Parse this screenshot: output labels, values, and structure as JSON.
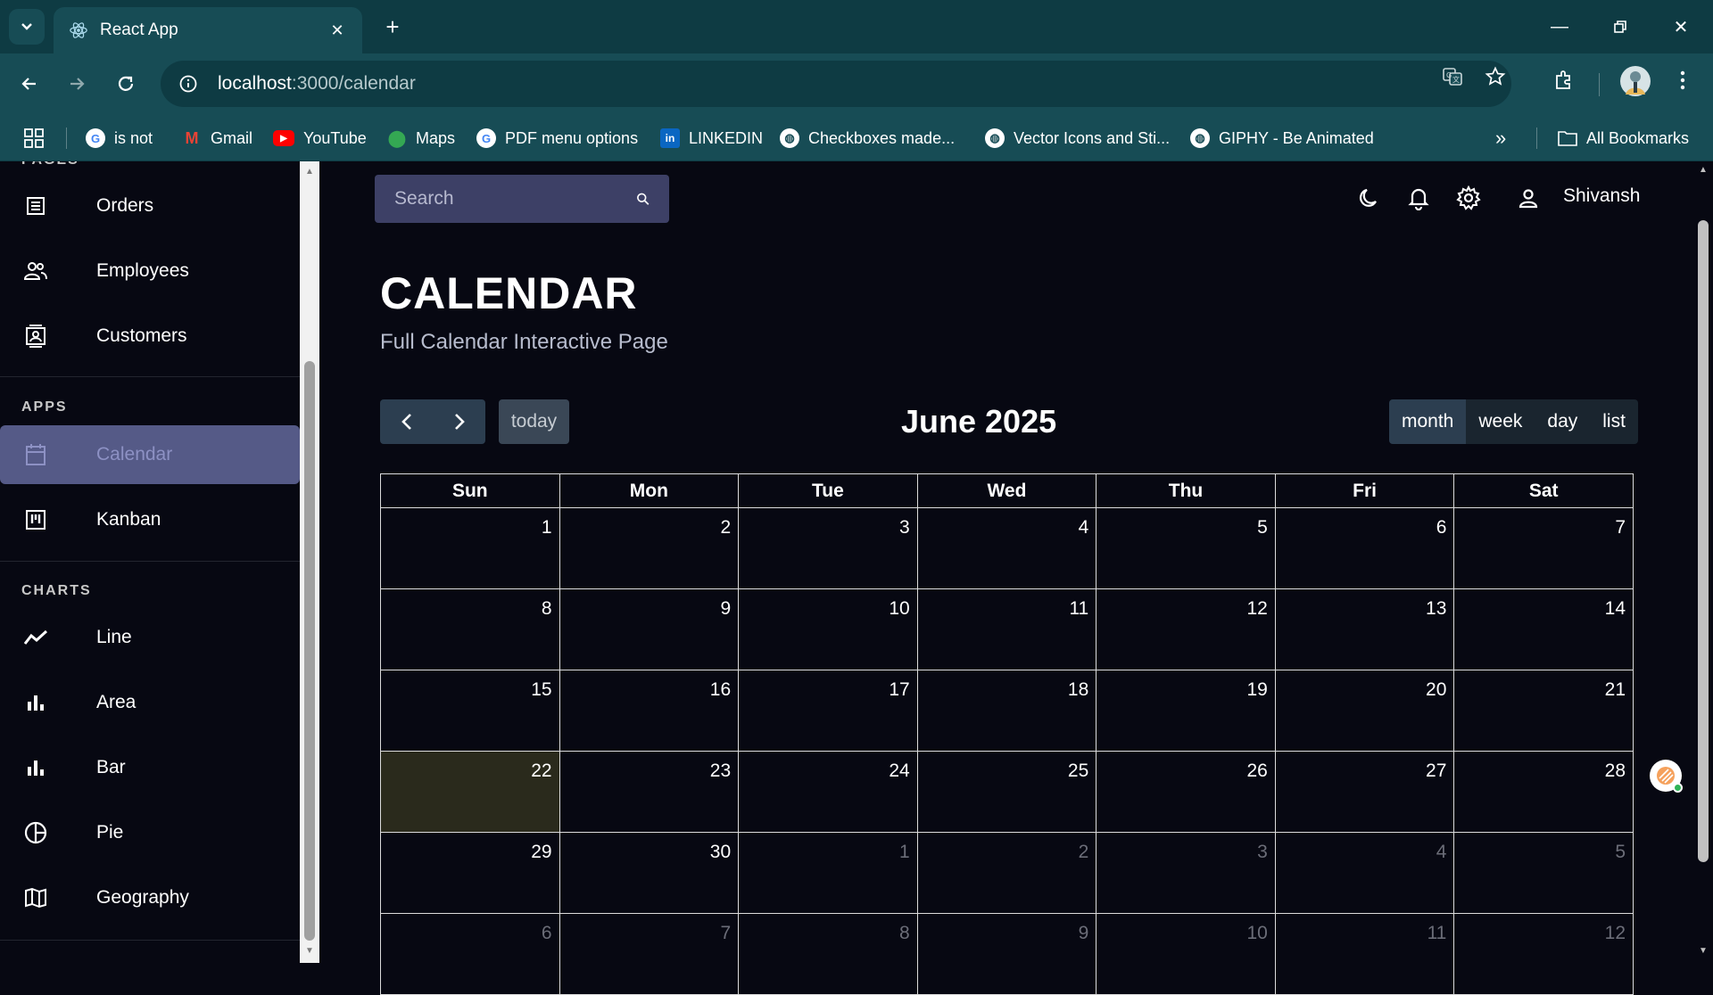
{
  "browser": {
    "tab_title": "React App",
    "url_host": "localhost",
    "url_path": ":3000/calendar",
    "bookmarks": [
      {
        "label": "is not",
        "icon": "google-icon"
      },
      {
        "label": "Gmail",
        "icon": "gmail-icon"
      },
      {
        "label": "YouTube",
        "icon": "youtube-icon"
      },
      {
        "label": "Maps",
        "icon": "maps-icon"
      },
      {
        "label": "PDF menu options",
        "icon": "google-icon"
      },
      {
        "label": "LINKEDIN",
        "icon": "linkedin-icon"
      },
      {
        "label": "Checkboxes made...",
        "icon": "globe-icon"
      },
      {
        "label": "Vector Icons and Sti...",
        "icon": "globe-icon"
      },
      {
        "label": "GIPHY - Be Animated",
        "icon": "globe-icon"
      }
    ],
    "all_bookmarks": "All Bookmarks"
  },
  "sidebar": {
    "items_top": [
      {
        "label": "Orders",
        "icon": "receipt-icon"
      },
      {
        "label": "Employees",
        "icon": "people-icon"
      },
      {
        "label": "Customers",
        "icon": "contacts-icon"
      }
    ],
    "apps_header": "APPS",
    "apps": [
      {
        "label": "Calendar",
        "icon": "calendar-icon",
        "active": true
      },
      {
        "label": "Kanban",
        "icon": "kanban-icon"
      }
    ],
    "charts_header": "CHARTS",
    "charts": [
      {
        "label": "Line",
        "icon": "line-chart-icon"
      },
      {
        "label": "Area",
        "icon": "area-chart-icon"
      },
      {
        "label": "Bar",
        "icon": "bar-chart-icon"
      },
      {
        "label": "Pie",
        "icon": "pie-chart-icon"
      },
      {
        "label": "Geography",
        "icon": "map-icon"
      }
    ]
  },
  "topbar": {
    "search_placeholder": "Search",
    "username": "Shivansh"
  },
  "page": {
    "title": "CALENDAR",
    "subtitle": "Full Calendar Interactive Page"
  },
  "calendar": {
    "today_label": "today",
    "title": "June 2025",
    "views": [
      "month",
      "week",
      "day",
      "list"
    ],
    "active_view": "month",
    "weekdays": [
      "Sun",
      "Mon",
      "Tue",
      "Wed",
      "Thu",
      "Fri",
      "Sat"
    ],
    "weeks": [
      [
        "1",
        "2",
        "3",
        "4",
        "5",
        "6",
        "7"
      ],
      [
        "8",
        "9",
        "10",
        "11",
        "12",
        "13",
        "14"
      ],
      [
        "15",
        "16",
        "17",
        "18",
        "19",
        "20",
        "21"
      ],
      [
        "22",
        "23",
        "24",
        "25",
        "26",
        "27",
        "28"
      ],
      [
        "29",
        "30",
        "1",
        "2",
        "3",
        "4",
        "5"
      ],
      [
        "6",
        "7",
        "8",
        "9",
        "10",
        "11",
        "12"
      ]
    ],
    "today_date": "22"
  }
}
